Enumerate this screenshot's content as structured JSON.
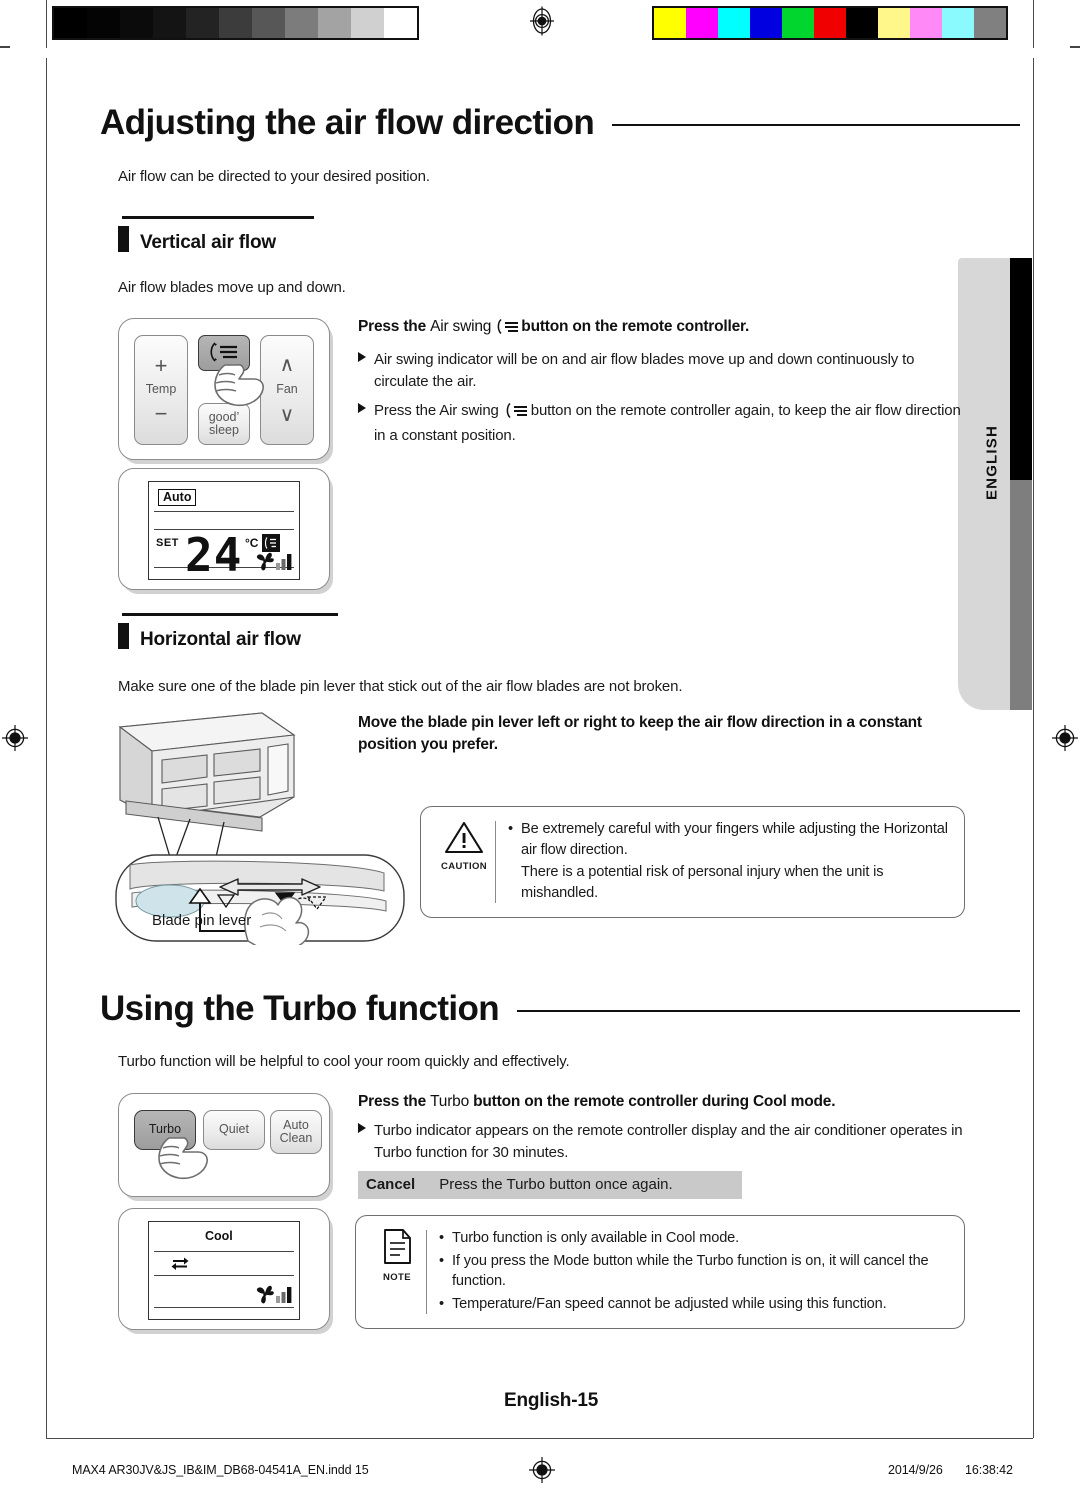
{
  "calibration": {
    "gray_swatches": [
      "#000000",
      "#040404",
      "#0b0b0b",
      "#141414",
      "#232323",
      "#3c3c3c",
      "#575757",
      "#7c7c7c",
      "#a3a3a3",
      "#d0d0d0",
      "#ffffff"
    ],
    "color_swatches": [
      "#ffff00",
      "#ff00ff",
      "#00ffff",
      "#0000e0",
      "#00d62e",
      "#f00000",
      "#000000",
      "#fff78a",
      "#ff8af7",
      "#8afaff",
      "#808080"
    ],
    "registration_mark": "registration-target-icon"
  },
  "side_tab": {
    "label": "ENGLISH"
  },
  "sections": {
    "airflow": {
      "title": "Adjusting the air flow direction",
      "intro": "Air flow can be directed to your desired position.",
      "vertical": {
        "heading": "Vertical air flow",
        "intro": "Air flow blades move up and down.",
        "instruction": {
          "lead": "Press the",
          "key": "Air swing",
          "tail": "button on the remote controller.",
          "bullets": [
            "Air swing indicator will be on and air flow blades move up and down continuously to circulate the air.",
            "Press the Air swing  button on the remote controller again, to keep the air flow direction in a constant position."
          ],
          "bullet2_lead": "Press the",
          "bullet2_key": "Air swing",
          "bullet2_tail": "button on the remote controller again, to keep the air flow direction in a constant position."
        },
        "remote": {
          "keys": [
            {
              "name": "temp-key",
              "label_top": "+",
              "label_mid": "Temp",
              "label_bot": "−",
              "state": "normal"
            },
            {
              "name": "air-swing-key",
              "label": "air-swing-icon",
              "state": "pressed"
            },
            {
              "name": "fan-key",
              "label_top": "∧",
              "label_mid": "Fan",
              "label_bot": "∨",
              "state": "normal"
            },
            {
              "name": "good-sleep-key",
              "label_top": "good’",
              "label_bot": "sleep",
              "state": "normal"
            }
          ],
          "hand_icon": "pointing-hand-icon"
        },
        "display": {
          "mode": "Auto",
          "set_label": "SET",
          "temperature": "24",
          "unit": "°C",
          "icons": [
            "air-swing-indicator-icon",
            "fan-blade-icon",
            "fan-speed-bars-icon"
          ]
        }
      },
      "horizontal": {
        "heading": "Horizontal air flow",
        "intro": "Make sure one of the blade pin lever that stick out of the air flow blades are not broken.",
        "instruction": "Move the blade pin lever left or right to keep the air flow direction in a constant position you prefer.",
        "diagram_caption": "Blade pin lever",
        "caution": {
          "icon_label": "CAUTION",
          "items": [
            "Be extremely careful with your fingers while adjusting the Horizontal air flow direction.",
            "There is a potential risk of personal injury when the unit is mishandled."
          ]
        }
      }
    },
    "turbo": {
      "title": "Using the Turbo function",
      "intro": "Turbo function will be helpful to cool your room quickly and effectively.",
      "instruction": {
        "lead": "Press the",
        "key": "Turbo",
        "tail": "button on the remote controller during Cool mode.",
        "bullets": [
          "Turbo indicator appears on the remote controller display and the air conditioner operates in Turbo function for 30 minutes."
        ],
        "cancel_label": "Cancel",
        "cancel_text": "Press the Turbo button once again."
      },
      "remote": {
        "keys": [
          {
            "name": "turbo-key",
            "label": "Turbo",
            "state": "pressed"
          },
          {
            "name": "quiet-key",
            "label": "Quiet",
            "state": "normal"
          },
          {
            "name": "auto-clean-key",
            "label_top": "Auto",
            "label_bot": "Clean",
            "state": "normal"
          }
        ],
        "hand_icon": "pointing-hand-icon"
      },
      "display": {
        "mode": "Cool",
        "icons": [
          "turbo-indicator-icon",
          "fan-blade-icon",
          "fan-speed-bars-icon"
        ]
      },
      "note": {
        "icon_label": "NOTE",
        "items": [
          "Turbo function is only available in Cool mode.",
          "If you press the Mode button while the Turbo function is on, it will cancel the function.",
          "Temperature/Fan speed cannot be adjusted while using this function."
        ]
      }
    }
  },
  "footer": {
    "page_number": "English-15",
    "file_name": "MAX4 AR30JV&JS_IB&IM_DB68-04541A_EN.indd   15",
    "date": "2014/9/26",
    "time": "16:38:42"
  }
}
